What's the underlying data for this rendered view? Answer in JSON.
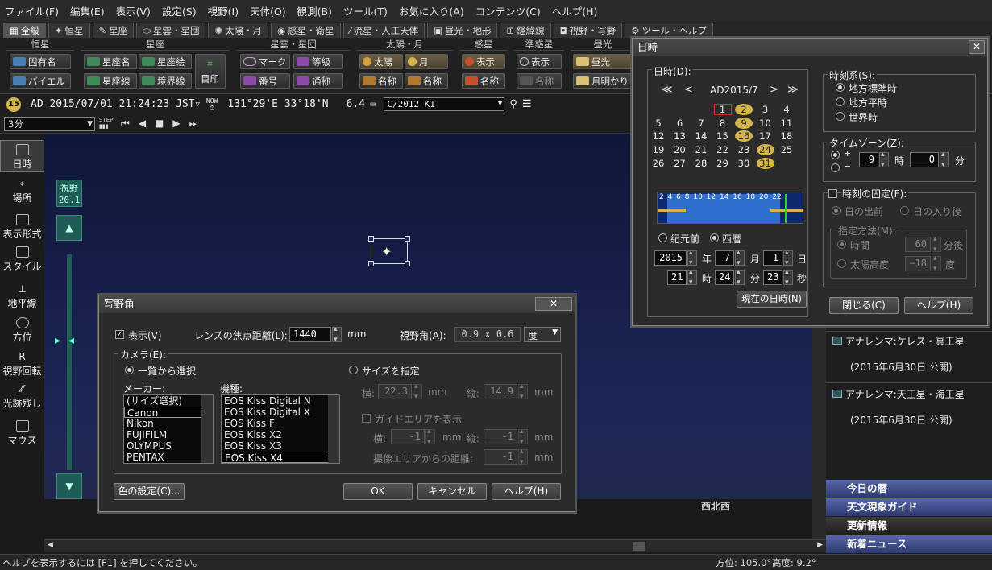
{
  "menu": [
    "ファイル(F)",
    "編集(E)",
    "表示(V)",
    "設定(S)",
    "視野(I)",
    "天体(O)",
    "観測(B)",
    "ツール(T)",
    "お気に入り(A)",
    "コンテンツ(C)",
    "ヘルプ(H)"
  ],
  "tabs": [
    "全般",
    "恒星",
    "星座",
    "星雲・星団",
    "太陽・月",
    "惑星・衛星",
    "流星・人工天体",
    "昼光・地形",
    "経緯線",
    "視野・写野",
    "ツール・ヘルプ"
  ],
  "ribbon": {
    "groups": [
      "恒星",
      "星座",
      "星雲・星団",
      "太陽・月",
      "惑星",
      "準惑星",
      "昼光"
    ],
    "star": [
      "固有名",
      "バイエル"
    ],
    "const": [
      "星座名",
      "星座絵",
      "星座線",
      "境界線",
      "目印"
    ],
    "neb": [
      "マーク",
      "等級",
      "番号",
      "通称"
    ],
    "sunmoon": [
      "太陽",
      "月",
      "名称",
      "名称"
    ],
    "planet": [
      "表示",
      "名称"
    ],
    "dwarf": [
      "表示",
      "名称"
    ],
    "day": [
      "昼光",
      "月明かり"
    ]
  },
  "status": {
    "badge": "15",
    "date": "AD 2015/07/01 21:24:23 JST",
    "now": "NOW",
    "coords": "131°29'E 33°18'N",
    "mag": "6.4",
    "target": "C/2012 K1",
    "step": "3分",
    "step_label": "STEP"
  },
  "leftbar": [
    "日時",
    "場所",
    "表示形式",
    "スタイル",
    "地平線",
    "方位",
    "視野回転",
    "光跡残し",
    "マウス"
  ],
  "fov": {
    "label": "視野",
    "value": "20.1"
  },
  "sky": {
    "direction": "西北西"
  },
  "statusbar": {
    "help": "ヘルプを表示するには [F1] を押してください。",
    "azimuth": "方位: 105.0°",
    "altitude": "高度: 9.2°"
  },
  "rightpanel": {
    "items": [
      "アナレンマ:ケレス・冥王星",
      "(2015年6月30日 公開)",
      "アナレンマ:天王星・海王星",
      "(2015年6月30日 公開)"
    ],
    "tabs": [
      "今日の暦",
      "天文現象ガイド",
      "更新情報",
      "新着ニュース"
    ]
  },
  "datetime_dlg": {
    "title": "日時",
    "date_label": "日時(D):",
    "month": "AD2015/7",
    "nav": [
      "≪",
      "<",
      ">",
      "≫"
    ],
    "days": [
      [
        "",
        "",
        "",
        "1",
        "2",
        "3",
        "4"
      ],
      [
        "5",
        "6",
        "7",
        "8",
        "9",
        "10",
        "11"
      ],
      [
        "12",
        "13",
        "14",
        "15",
        "16",
        "17",
        "18"
      ],
      [
        "19",
        "20",
        "21",
        "22",
        "23",
        "24",
        "25"
      ],
      [
        "26",
        "27",
        "28",
        "29",
        "30",
        "31",
        ""
      ]
    ],
    "hours": "2 4 6 8 10 12 14 16 18 20 22",
    "era": [
      "紀元前",
      "西暦"
    ],
    "year": "2015",
    "month_v": "7",
    "day_v": "1",
    "hour": "21",
    "minute": "24",
    "second": "23",
    "units": [
      "年",
      "月",
      "日",
      "時",
      "分",
      "秒"
    ],
    "now_btn": "現在の日時(N)",
    "tz_system_label": "時刻系(S):",
    "tz_system": [
      "地方標準時",
      "地方平時",
      "世界時"
    ],
    "tz_label": "タイムゾーン(Z):",
    "tz_plus": "+",
    "tz_minus": "−",
    "tz_hour": "9",
    "tz_min": "0",
    "tz_hour_unit": "時",
    "tz_min_unit": "分",
    "fix_label": "時刻の固定(F):",
    "fix_opts": [
      "日の出前",
      "日の入り後"
    ],
    "method_label": "指定方法(M):",
    "method": [
      "時間",
      "太陽高度"
    ],
    "method_time": "60",
    "method_time_unit": "分後",
    "method_alt": "−18",
    "method_alt_unit": "度",
    "close": "閉じる(C)",
    "help": "ヘルプ(H)"
  },
  "fov_dlg": {
    "title": "写野角",
    "show": "表示(V)",
    "focal_label": "レンズの焦点距離(L):",
    "focal": "1440",
    "focal_unit": "mm",
    "angle_label": "視野角(A):",
    "angle": "0.9 x 0.6",
    "angle_unit": "度",
    "camera_label": "カメラ(E):",
    "from_list": "一覧から選択",
    "by_size": "サイズを指定",
    "maker_label": "メーカー:",
    "makers": [
      "(サイズ選択)",
      "Canon",
      "Nikon",
      "FUJIFILM",
      "OLYMPUS",
      "PENTAX"
    ],
    "model_label": "機種:",
    "models": [
      "EOS Kiss Digital N",
      "EOS Kiss Digital X",
      "EOS Kiss F",
      "EOS Kiss X2",
      "EOS Kiss X3",
      "EOS Kiss X4"
    ],
    "w_label": "横:",
    "w": "22.3",
    "h_label": "縦:",
    "h": "14.9",
    "mm": "mm",
    "guide": "ガイドエリアを表示",
    "gw_label": "横:",
    "gw": "-1",
    "gh_label": "縦:",
    "gh": "-1",
    "dist_label": "撮像エリアからの距離:",
    "dist": "-1",
    "color_btn": "色の設定(C)...",
    "ok": "OK",
    "cancel": "キャンセル",
    "help": "ヘルプ(H)"
  },
  "colors": {
    "accent": "#d4b54a",
    "today": "#cc3333",
    "bar": "#2f6fd0"
  }
}
